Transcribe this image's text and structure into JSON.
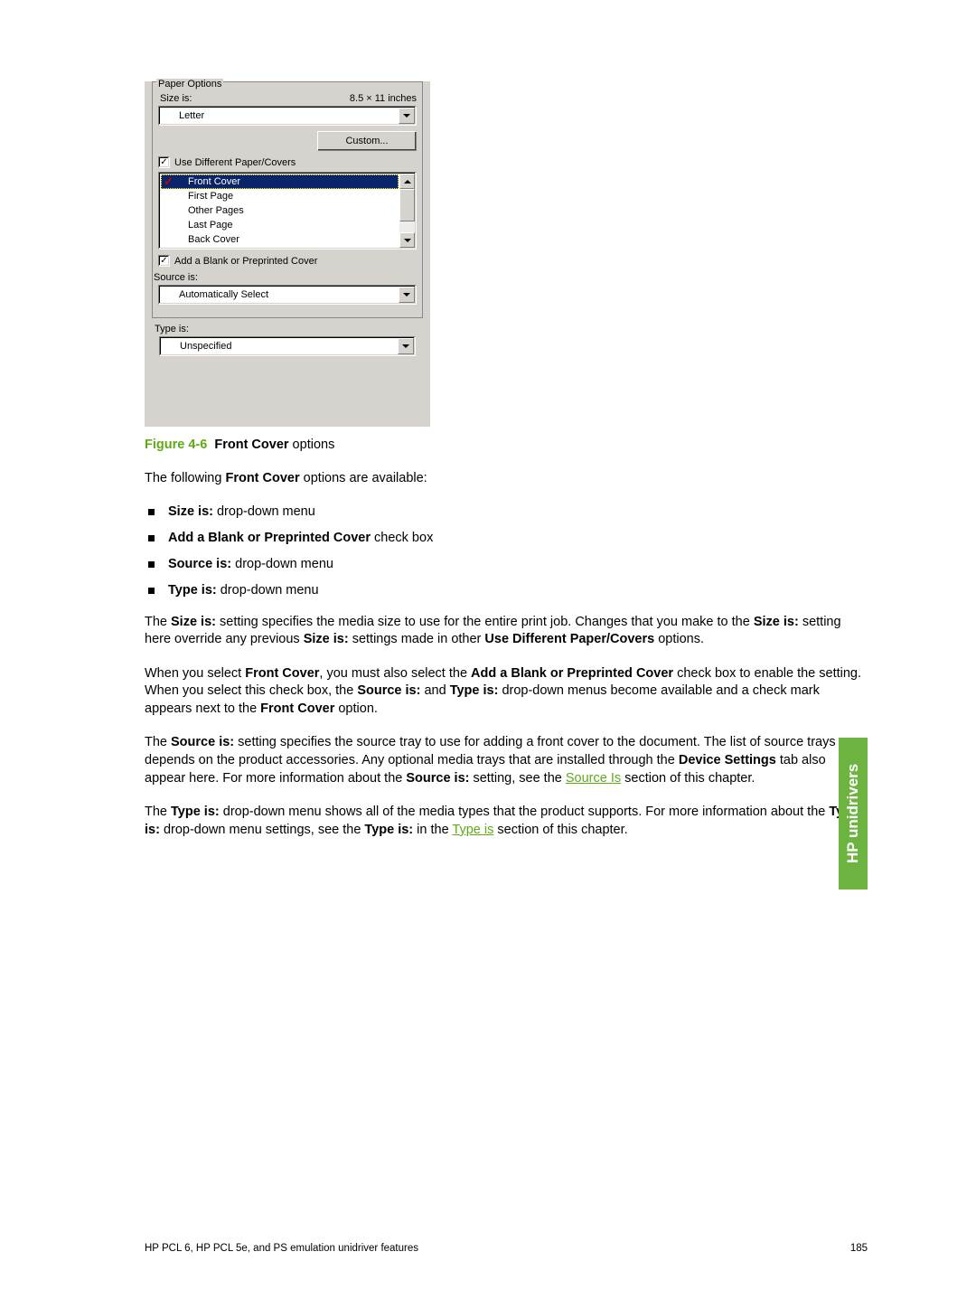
{
  "dlg": {
    "group_title": "Paper Options",
    "size_label": "Size is:",
    "size_dim": "8.5 × 11 inches",
    "size_value": "Letter",
    "custom_btn": "Custom...",
    "use_diff_label": "Use Different Paper/Covers",
    "use_diff_checked": true,
    "list": [
      {
        "label": "Front Cover",
        "selected": true,
        "checked": true
      },
      {
        "label": "First Page"
      },
      {
        "label": "Other Pages"
      },
      {
        "label": "Last Page"
      },
      {
        "label": "Back Cover"
      }
    ],
    "add_blank_label": "Add a Blank or Preprinted Cover",
    "add_blank_checked": true,
    "source_label": "Source is:",
    "source_value": "Automatically Select",
    "type_label": "Type is:",
    "type_value": "Unspecified"
  },
  "caption": {
    "fignum": "Figure 4-6",
    "bold": "Front Cover",
    "suffix": " options"
  },
  "intro": {
    "pre": "The following ",
    "bold": "Front Cover",
    "post": " options are available:"
  },
  "bullets": [
    {
      "bold": "Size is:",
      "rest": " drop-down menu"
    },
    {
      "bold": "Add a Blank or Preprinted Cover",
      "rest": " check box"
    },
    {
      "bold": "Source is:",
      "rest": " drop-down menu"
    },
    {
      "bold": "Type is:",
      "rest": " drop-down menu"
    }
  ],
  "p1": {
    "a": "The ",
    "b": "Size is:",
    "c": " setting specifies the media size to use for the entire print job. Changes that you make to the ",
    "d": "Size is:",
    "e": " setting here override any previous ",
    "f": "Size is:",
    "g": " settings made in other ",
    "h": "Use Different Paper/Covers",
    "i": " options."
  },
  "p2": {
    "a": "When you select ",
    "b": "Front Cover",
    "c": ", you must also select the ",
    "d": "Add a Blank or Preprinted Cover",
    "e": " check box to enable the setting. When you select this check box, the ",
    "f": "Source is:",
    "g": " and ",
    "h": "Type is:",
    "i": " drop-down menus become available and a check mark appears next to the ",
    "j": "Front Cover",
    "k": " option."
  },
  "p3": {
    "a": "The ",
    "b": "Source is:",
    "c": " setting specifies the source tray to use for adding a front cover to the document. The list of source trays depends on the product accessories. Any optional media trays that are installed through the ",
    "d": "Device Settings",
    "e": " tab also appear here. For more information about the ",
    "f": "Source is:",
    "g": " setting, see the ",
    "link": "Source Is",
    "h": " section of this chapter."
  },
  "p4": {
    "a": "The ",
    "b": "Type is:",
    "c": " drop-down menu shows all of the media types that the product supports. For more information about the ",
    "d": "Type is:",
    "e": " drop-down menu settings, see the ",
    "f": "Type is:",
    "g": " in the ",
    "link": "Type is",
    "h": " section of this chapter."
  },
  "side_tab": "HP unidrivers",
  "footer": {
    "left": "HP PCL 6, HP PCL 5e, and PS emulation unidriver features",
    "right": "185"
  }
}
